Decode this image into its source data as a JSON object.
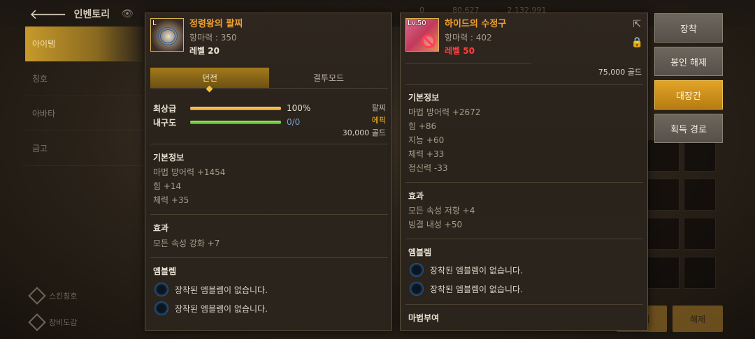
{
  "topbar": {
    "back_label": "인벤토리",
    "stats": [
      "0",
      "80,627",
      "2,132,991"
    ]
  },
  "left_menu": {
    "items": [
      "아이템",
      "칭호",
      "아바타",
      "금고"
    ]
  },
  "left_bottom": {
    "items": [
      "스킨칭호",
      "장비도감"
    ]
  },
  "bottom_buttons": [
    "해제",
    "해제"
  ],
  "panel_left": {
    "name": "정령왕의 팔찌",
    "icon": "bracelet-icon",
    "icon_level": "L",
    "stat": "항마력 : 350",
    "level": "레벨 20",
    "tabs": [
      "던전",
      "결투모드"
    ],
    "bars": [
      {
        "label": "최상급",
        "value": "100%",
        "fill": 1.0,
        "color": "orange"
      },
      {
        "label": "내구도",
        "value": "0/0",
        "fill": 1.0,
        "color": "green"
      }
    ],
    "right_info": {
      "type": "팔찌",
      "rarity": "에픽",
      "price": "30,000 골드"
    },
    "basic_title": "기본정보",
    "basic_lines": [
      "마법 방어력 +1454",
      "힘 +14",
      "체력 +35"
    ],
    "effect_title": "효과",
    "effect_lines": [
      "모든 속성 강화 +7"
    ],
    "emblem_title": "엠블렘",
    "emblem_lines": [
      "장착된 엠블렘이 없습니다.",
      "장착된 엠블렘이 없습니다."
    ]
  },
  "panel_right": {
    "name": "하이드의 수정구",
    "icon": "orb-icon",
    "icon_level": "Lv.50",
    "stat": "항마력 : 402",
    "level": "레벨 50",
    "price": "75,000 골드",
    "basic_title": "기본정보",
    "basic_lines": [
      "마법 방어력 +2672",
      "힘 +86",
      "지능 +60",
      "체력 +33",
      "정신력 -33"
    ],
    "effect_title": "효과",
    "effect_lines": [
      "모든 속성 저항 +4",
      "빙결 내성 +50"
    ],
    "emblem_title": "엠블렘",
    "emblem_lines": [
      "장착된 엠블렘이 없습니다.",
      "장착된 엠블렘이 없습니다."
    ],
    "enchant_title": "마법부여"
  },
  "actions": {
    "equip": "장착",
    "unseal": "봉인 해제",
    "blacksmith": "대장간",
    "obtain_route": "획득 경로"
  }
}
